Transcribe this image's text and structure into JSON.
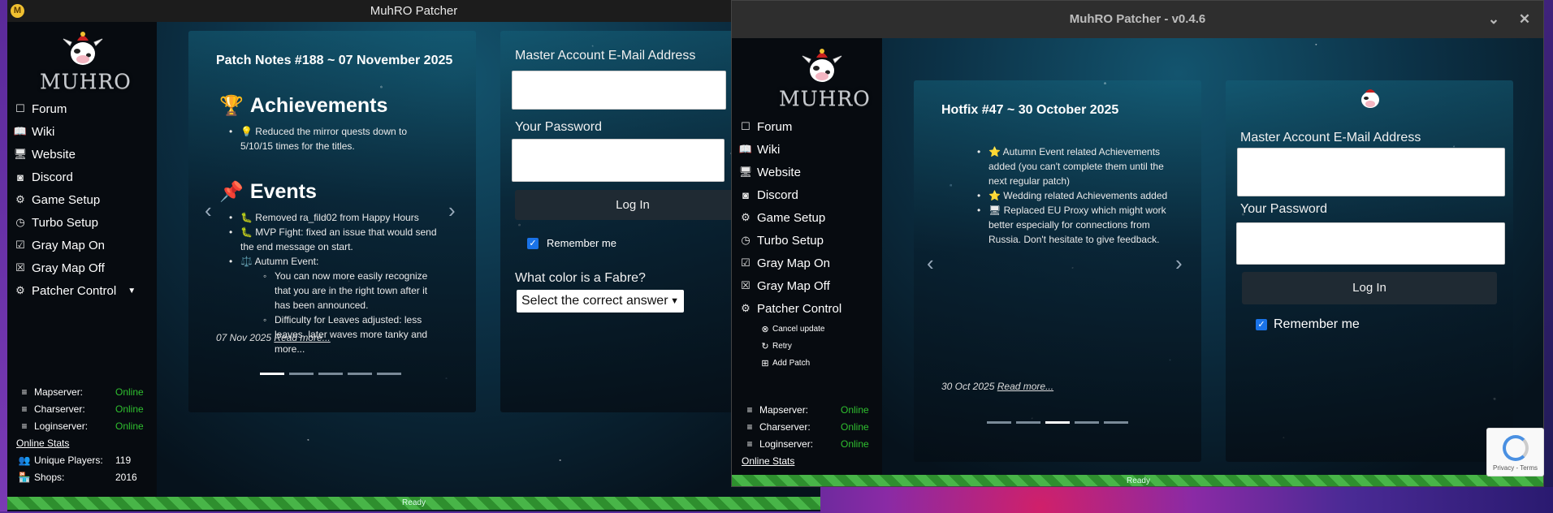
{
  "window_a": {
    "title": "MuhRO Patcher",
    "logo_text": "MUHRO",
    "nav": [
      {
        "label": "Forum",
        "icon": "☐"
      },
      {
        "label": "Wiki",
        "icon": "📖"
      },
      {
        "label": "Website",
        "icon": "🖥"
      },
      {
        "label": "Discord",
        "icon": "◙"
      },
      {
        "label": "Game Setup",
        "icon": "⚙"
      },
      {
        "label": "Turbo Setup",
        "icon": "◷"
      },
      {
        "label": "Gray Map On",
        "icon": "☑"
      },
      {
        "label": "Gray Map Off",
        "icon": "☒"
      },
      {
        "label": "Patcher Control",
        "icon": "⚙",
        "caret": "▼"
      }
    ],
    "status": {
      "mapserver": {
        "label": "Mapserver:",
        "value": "Online"
      },
      "charserver": {
        "label": "Charserver:",
        "value": "Online"
      },
      "loginserver": {
        "label": "Loginserver:",
        "value": "Online"
      },
      "online_stats": "Online Stats",
      "unique_players": {
        "label": "Unique Players:",
        "value": "119"
      },
      "shops": {
        "label": "Shops:",
        "value": "2016"
      }
    },
    "notes": {
      "title": "Patch Notes #188 ~ 07 November 2025",
      "achievements_heading": "Achievements",
      "achievements_emoji": "🏆",
      "achievements_items": [
        "💡 Reduced the mirror quests down to 5/10/15 times for the titles."
      ],
      "events_heading": "Events",
      "events_emoji": "📌",
      "events_items": [
        "🐛 Removed ra_fild02 from Happy Hours",
        "🐛 MVP Fight: fixed an issue that would send the end message on start.",
        "⚖️ Autumn Event:"
      ],
      "events_sub_items": [
        "You can now more easily recognize that you are in the right town after it has been announced.",
        "Difficulty for Leaves adjusted: less leaves, later waves more tanky and more..."
      ],
      "date": "07 Nov 2025",
      "read_more": "Read more...",
      "prev": "‹",
      "next": "›"
    },
    "login": {
      "email_label": "Master Account E-Mail Address",
      "password_label": "Your Password",
      "login_button": "Log In",
      "remember_label": "Remember me",
      "captcha_question": "What color is a Fabre?",
      "captcha_select": "Select the correct answer",
      "captcha_caret": "▼"
    },
    "progress_text": "Ready"
  },
  "window_b": {
    "title": "MuhRO Patcher - v0.4.6",
    "logo_text": "MUHRO",
    "minimize_icon": "⌄",
    "close_icon": "✕",
    "nav": [
      {
        "label": "Forum",
        "icon": "☐"
      },
      {
        "label": "Wiki",
        "icon": "📖"
      },
      {
        "label": "Website",
        "icon": "🖥"
      },
      {
        "label": "Discord",
        "icon": "◙"
      },
      {
        "label": "Game Setup",
        "icon": "⚙"
      },
      {
        "label": "Turbo Setup",
        "icon": "◷"
      },
      {
        "label": "Gray Map On",
        "icon": "☑"
      },
      {
        "label": "Gray Map Off",
        "icon": "☒"
      },
      {
        "label": "Patcher Control",
        "icon": "⚙"
      }
    ],
    "patcher_sub": [
      {
        "label": "Cancel update",
        "icon": "⊗"
      },
      {
        "label": "Retry",
        "icon": "↻"
      },
      {
        "label": "Add Patch",
        "icon": "⊞"
      }
    ],
    "status": {
      "mapserver": {
        "label": "Mapserver:",
        "value": "Online"
      },
      "charserver": {
        "label": "Charserver:",
        "value": "Online"
      },
      "loginserver": {
        "label": "Loginserver:",
        "value": "Online"
      },
      "online_stats": "Online Stats"
    },
    "notes": {
      "title": "Hotfix #47 ~ 30 October 2025",
      "items": [
        "⭐ Autumn Event related Achievements added (you can't complete them until the next regular patch)",
        "⭐ Wedding related Achievements added",
        "🖥 Replaced EU Proxy which might work better especially for connections from Russia. Don't hesitate to give feedback."
      ],
      "date": "30 Oct 2025",
      "read_more": "Read more...",
      "prev": "‹",
      "next": "›"
    },
    "login": {
      "email_label": "Master Account E-Mail Address",
      "password_label": "Your Password",
      "login_button": "Log In",
      "remember_label": "Remember me"
    },
    "progress_text": "Ready",
    "recaptcha_terms": "Privacy - Terms"
  }
}
